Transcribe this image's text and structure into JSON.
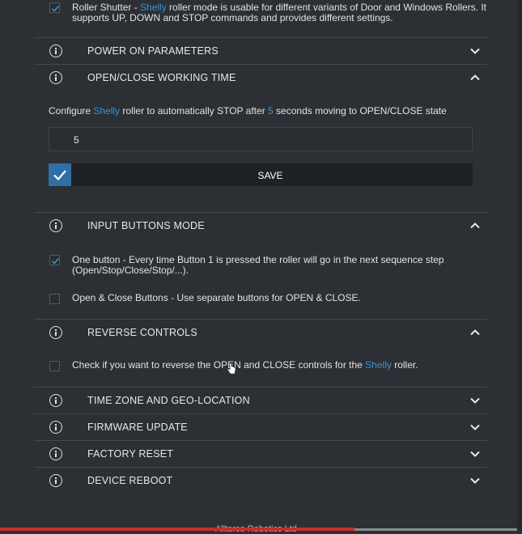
{
  "top_option": {
    "prefix": "Roller Shutter - ",
    "brand": "Shelly",
    "line1_rest": " roller mode is usable for different variants of Door and Windows Rollers. It",
    "line2": "supports UP, DOWN and STOP commands and provides different settings."
  },
  "sections": {
    "power_on": "POWER ON PARAMETERS",
    "open_close": "OPEN/CLOSE WORKING TIME",
    "input_buttons": "INPUT BUTTONS MODE",
    "reverse": "REVERSE CONTROLS",
    "timezone": "TIME ZONE AND GEO-LOCATION",
    "firmware": "FIRMWARE UPDATE",
    "factory": "FACTORY RESET",
    "reboot": "DEVICE REBOOT"
  },
  "open_close": {
    "desc_a": "Configure ",
    "desc_brand": "Shelly",
    "desc_b": " roller to automatically STOP after ",
    "desc_value": "5",
    "desc_c": " seconds moving to OPEN/CLOSE state",
    "input_value": "5",
    "save_label": "SAVE"
  },
  "input_buttons": {
    "one_button_l1": "One button - Every time Button 1 is pressed the roller will go in the next sequence step",
    "one_button_l2": "(Open/Stop/Close/Stop/...).",
    "open_close_buttons": "Open & Close Buttons - Use separate buttons for OPEN & CLOSE."
  },
  "reverse": {
    "desc_a": "Check if you want to reverse the OPEN and CLOSE controls for the ",
    "desc_brand": "Shelly",
    "desc_b": " roller."
  },
  "footer": {
    "text": "Allterco Robotics Ltd"
  },
  "colors": {
    "accent": "#3a93d6",
    "background": "#2c2f33",
    "save_check": "#2f6fa6"
  }
}
